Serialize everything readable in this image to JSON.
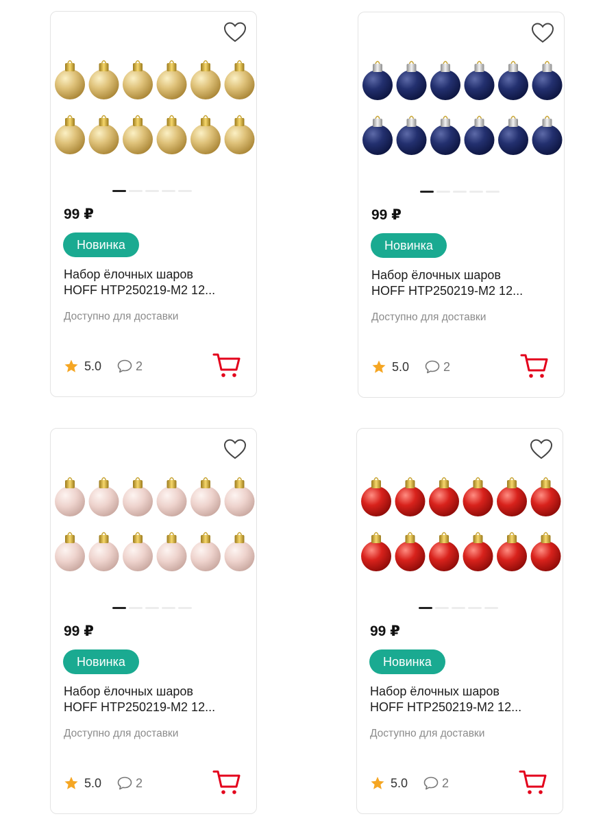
{
  "colors": {
    "badge": "#1aaa91",
    "cart": "#e3001b",
    "star": "#f5a623",
    "ball_colors": [
      "gold",
      "navy",
      "pink",
      "red"
    ]
  },
  "icons": {
    "favorite": "heart-outline-icon",
    "rating": "star-icon",
    "reviews": "comment-icon",
    "cart": "cart-icon"
  },
  "products": [
    {
      "price": "99 ₽",
      "badge": "Новинка",
      "title_line1": "Набор ёлочных шаров",
      "title_line2": "HOFF HTP250219-M2 12...",
      "availability": "Доступно для доставки",
      "rating": "5.0",
      "reviews": "2",
      "ball_color": "gold"
    },
    {
      "price": "99 ₽",
      "badge": "Новинка",
      "title_line1": "Набор ёлочных шаров",
      "title_line2": "HOFF HTP250219-M2 12...",
      "availability": "Доступно для доставки",
      "rating": "5.0",
      "reviews": "2",
      "ball_color": "navy"
    },
    {
      "price": "99 ₽",
      "badge": "Новинка",
      "title_line1": "Набор ёлочных шаров",
      "title_line2": "HOFF HTP250219-M2 12...",
      "availability": "Доступно для доставки",
      "rating": "5.0",
      "reviews": "2",
      "ball_color": "pink"
    },
    {
      "price": "99 ₽",
      "badge": "Новинка",
      "title_line1": "Набор ёлочных шаров",
      "title_line2": "HOFF HTP250219-M2 12...",
      "availability": "Доступно для доставки",
      "rating": "5.0",
      "reviews": "2",
      "ball_color": "red"
    }
  ]
}
